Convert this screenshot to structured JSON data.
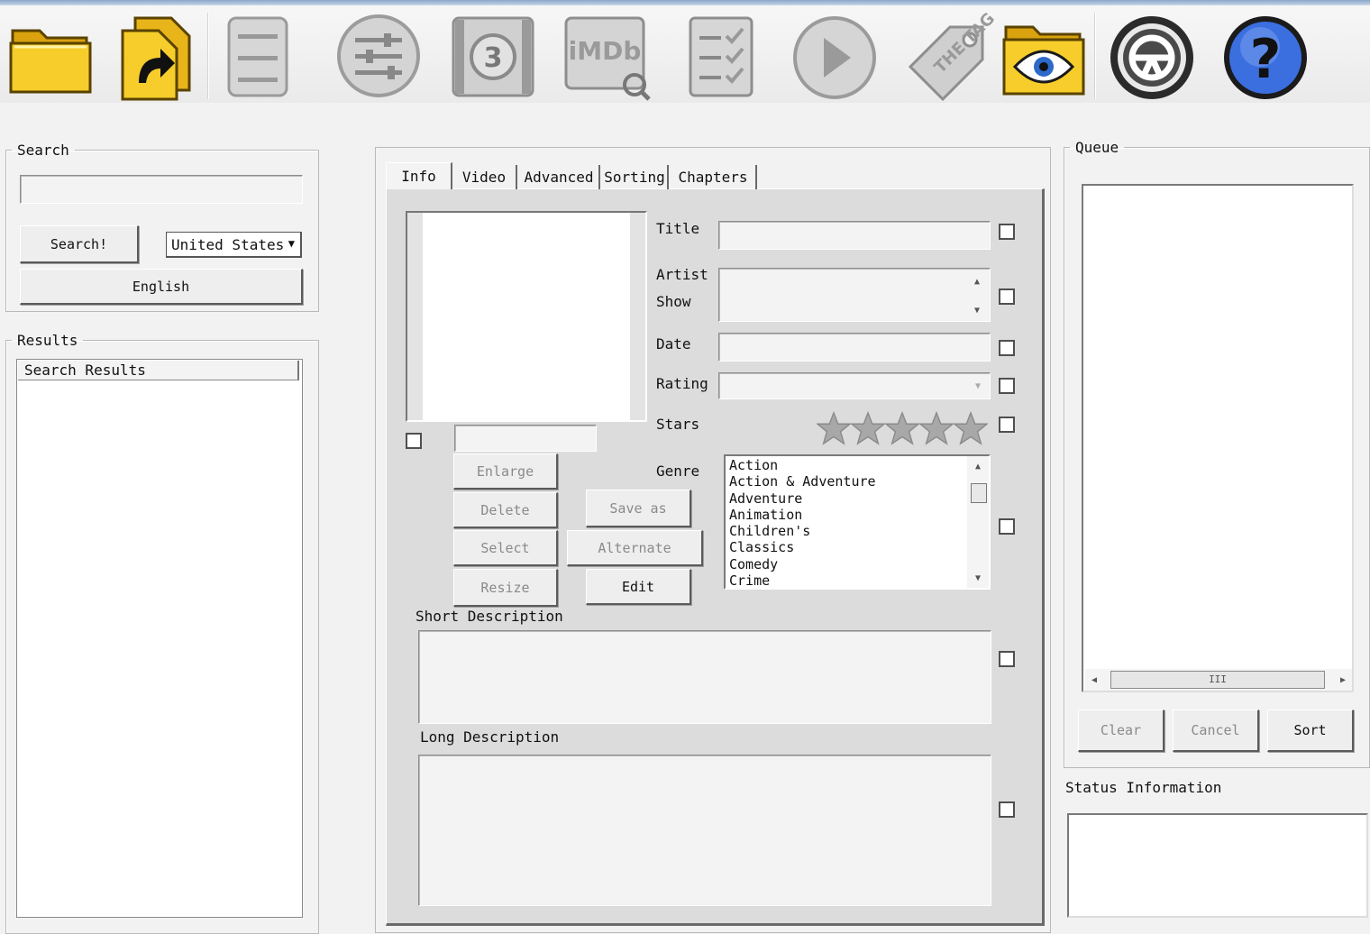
{
  "toolbar": {
    "icons": [
      "folder-open-icon",
      "folder-export-icon",
      "file-cabinet-icon",
      "settings-sliders-icon",
      "film-countdown-icon",
      "imdb-search-icon",
      "checklist-icon",
      "play-icon",
      "tag-icon",
      "folder-eye-icon",
      "web-icon",
      "help-icon"
    ],
    "imdb_text": "iMDb",
    "tag_text": "THE TAG"
  },
  "search": {
    "legend": "Search",
    "query": "",
    "button": "Search!",
    "country": "United States",
    "language": "English"
  },
  "results": {
    "legend": "Results",
    "header": "Search Results"
  },
  "tabs": [
    "Info",
    "Video",
    "Advanced",
    "Sorting",
    "Chapters"
  ],
  "info": {
    "labels": {
      "title": "Title",
      "artist": "Artist",
      "show": "Show",
      "date": "Date",
      "rating": "Rating",
      "stars": "Stars",
      "genre": "Genre",
      "short_desc": "Short Description",
      "long_desc": "Long Description"
    },
    "values": {
      "title": "",
      "artist_show": "",
      "date": "",
      "rating": "",
      "short_desc": "",
      "long_desc": "",
      "image_name": ""
    },
    "stars_count": 5,
    "stars_rating": 0,
    "image_buttons": {
      "enlarge": "Enlarge",
      "delete": "Delete",
      "select": "Select",
      "resize": "Resize"
    },
    "center_buttons": {
      "save_as": "Save as",
      "alternate": "Alternate",
      "edit": "Edit"
    },
    "genres": [
      "Action",
      "Action & Adventure",
      "Adventure",
      "Animation",
      "Children's",
      "Classics",
      "Comedy",
      "Crime"
    ]
  },
  "queue": {
    "legend": "Queue",
    "buttons": {
      "clear": "Clear",
      "cancel": "Cancel",
      "sort": "Sort"
    },
    "hscroll_thumb": "III"
  },
  "status": {
    "label": "Status Information",
    "text": ""
  },
  "colors": {
    "folder": "#f2c21b",
    "help_blue": "#2f5fd6",
    "dark_ring": "#222222"
  }
}
